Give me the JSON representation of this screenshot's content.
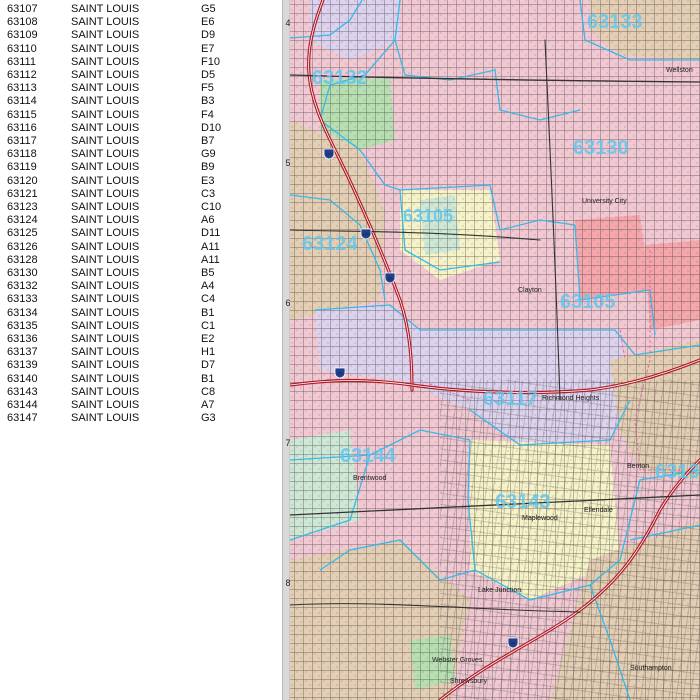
{
  "index": [
    {
      "zip": "63107",
      "city": "SAINT LOUIS",
      "grid": "G5"
    },
    {
      "zip": "63108",
      "city": "SAINT LOUIS",
      "grid": "E6"
    },
    {
      "zip": "63109",
      "city": "SAINT LOUIS",
      "grid": "D9"
    },
    {
      "zip": "63110",
      "city": "SAINT LOUIS",
      "grid": "E7"
    },
    {
      "zip": "63111",
      "city": "SAINT LOUIS",
      "grid": "F10"
    },
    {
      "zip": "63112",
      "city": "SAINT LOUIS",
      "grid": "D5"
    },
    {
      "zip": "63113",
      "city": "SAINT LOUIS",
      "grid": "F5"
    },
    {
      "zip": "63114",
      "city": "SAINT LOUIS",
      "grid": "B3"
    },
    {
      "zip": "63115",
      "city": "SAINT LOUIS",
      "grid": "F4"
    },
    {
      "zip": "63116",
      "city": "SAINT LOUIS",
      "grid": "D10"
    },
    {
      "zip": "63117",
      "city": "SAINT LOUIS",
      "grid": "B7"
    },
    {
      "zip": "63118",
      "city": "SAINT LOUIS",
      "grid": "G9"
    },
    {
      "zip": "63119",
      "city": "SAINT LOUIS",
      "grid": "B9"
    },
    {
      "zip": "63120",
      "city": "SAINT LOUIS",
      "grid": "E3"
    },
    {
      "zip": "63121",
      "city": "SAINT LOUIS",
      "grid": "C3"
    },
    {
      "zip": "63123",
      "city": "SAINT LOUIS",
      "grid": "C10"
    },
    {
      "zip": "63124",
      "city": "SAINT LOUIS",
      "grid": "A6"
    },
    {
      "zip": "63125",
      "city": "SAINT LOUIS",
      "grid": "D11"
    },
    {
      "zip": "63126",
      "city": "SAINT LOUIS",
      "grid": "A11"
    },
    {
      "zip": "63128",
      "city": "SAINT LOUIS",
      "grid": "A11"
    },
    {
      "zip": "63130",
      "city": "SAINT LOUIS",
      "grid": "B5"
    },
    {
      "zip": "63132",
      "city": "SAINT LOUIS",
      "grid": "A4"
    },
    {
      "zip": "63133",
      "city": "SAINT LOUIS",
      "grid": "C4"
    },
    {
      "zip": "63134",
      "city": "SAINT LOUIS",
      "grid": "B1"
    },
    {
      "zip": "63135",
      "city": "SAINT LOUIS",
      "grid": "C1"
    },
    {
      "zip": "63136",
      "city": "SAINT LOUIS",
      "grid": "E2"
    },
    {
      "zip": "63137",
      "city": "SAINT LOUIS",
      "grid": "H1"
    },
    {
      "zip": "63139",
      "city": "SAINT LOUIS",
      "grid": "D7"
    },
    {
      "zip": "63140",
      "city": "SAINT LOUIS",
      "grid": "B1"
    },
    {
      "zip": "63143",
      "city": "SAINT LOUIS",
      "grid": "C8"
    },
    {
      "zip": "63144",
      "city": "SAINT LOUIS",
      "grid": "A7"
    },
    {
      "zip": "63147",
      "city": "SAINT LOUIS",
      "grid": "G3"
    }
  ],
  "ruler": [
    "4",
    "5",
    "6",
    "7",
    "8"
  ],
  "map": {
    "zip_labels": [
      "63133",
      "63132",
      "63130",
      "63105",
      "63124",
      "63105",
      "63117",
      "63144",
      "63143",
      "6313"
    ],
    "places": [
      "University City",
      "Clayton",
      "Richmond Heights",
      "Brentwood",
      "Maplewood",
      "Lake Junction",
      "Webster Groves",
      "Shrewsbury",
      "Benton",
      "Ellendale",
      "Southampton",
      "Wellston"
    ],
    "highway_shields": [
      "170",
      "170",
      "64",
      "64",
      "44"
    ],
    "colors": {
      "zip_boundary": "#38b7e8",
      "highway": "#b11d2a",
      "pink": "#f2c9d3",
      "lavender": "#ddd3ee",
      "yellow": "#f7f3c8",
      "tan": "#e5cfb4",
      "green": "#b8dfb2",
      "mint": "#cfe8d6",
      "salmon": "#f5a7ab"
    }
  }
}
